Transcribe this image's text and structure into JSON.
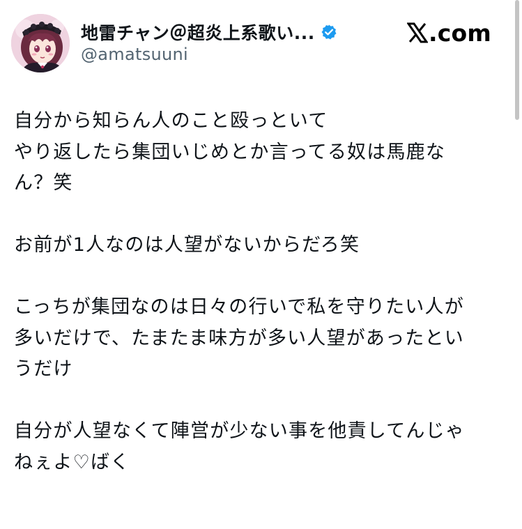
{
  "author": {
    "display_name": "地雷チャン＠超炎上系歌い...",
    "handle": "@amatsuuni",
    "verified": true,
    "verified_color": "#1d9bf0",
    "avatar_icon": "anime-girl-avatar"
  },
  "brand": {
    "icon": "x-logo-icon",
    "text": ".com"
  },
  "tweet": {
    "paragraphs": [
      [
        "自分から知らん人のこと殴っといて",
        "やり返したら集団いじめとか言ってる奴は馬鹿な",
        "ん？笑"
      ],
      [
        "お前が1人なのは人望がないからだろ笑"
      ],
      [
        "こっちが集団なのは日々の行いで私を守りたい人が",
        "多いだけで、たまたま味方が多い人望があったとい",
        "うだけ"
      ],
      [
        "自分が人望なくて陣営が少ない事を他責してんじゃ",
        "ねぇよ♡ばく"
      ]
    ]
  }
}
